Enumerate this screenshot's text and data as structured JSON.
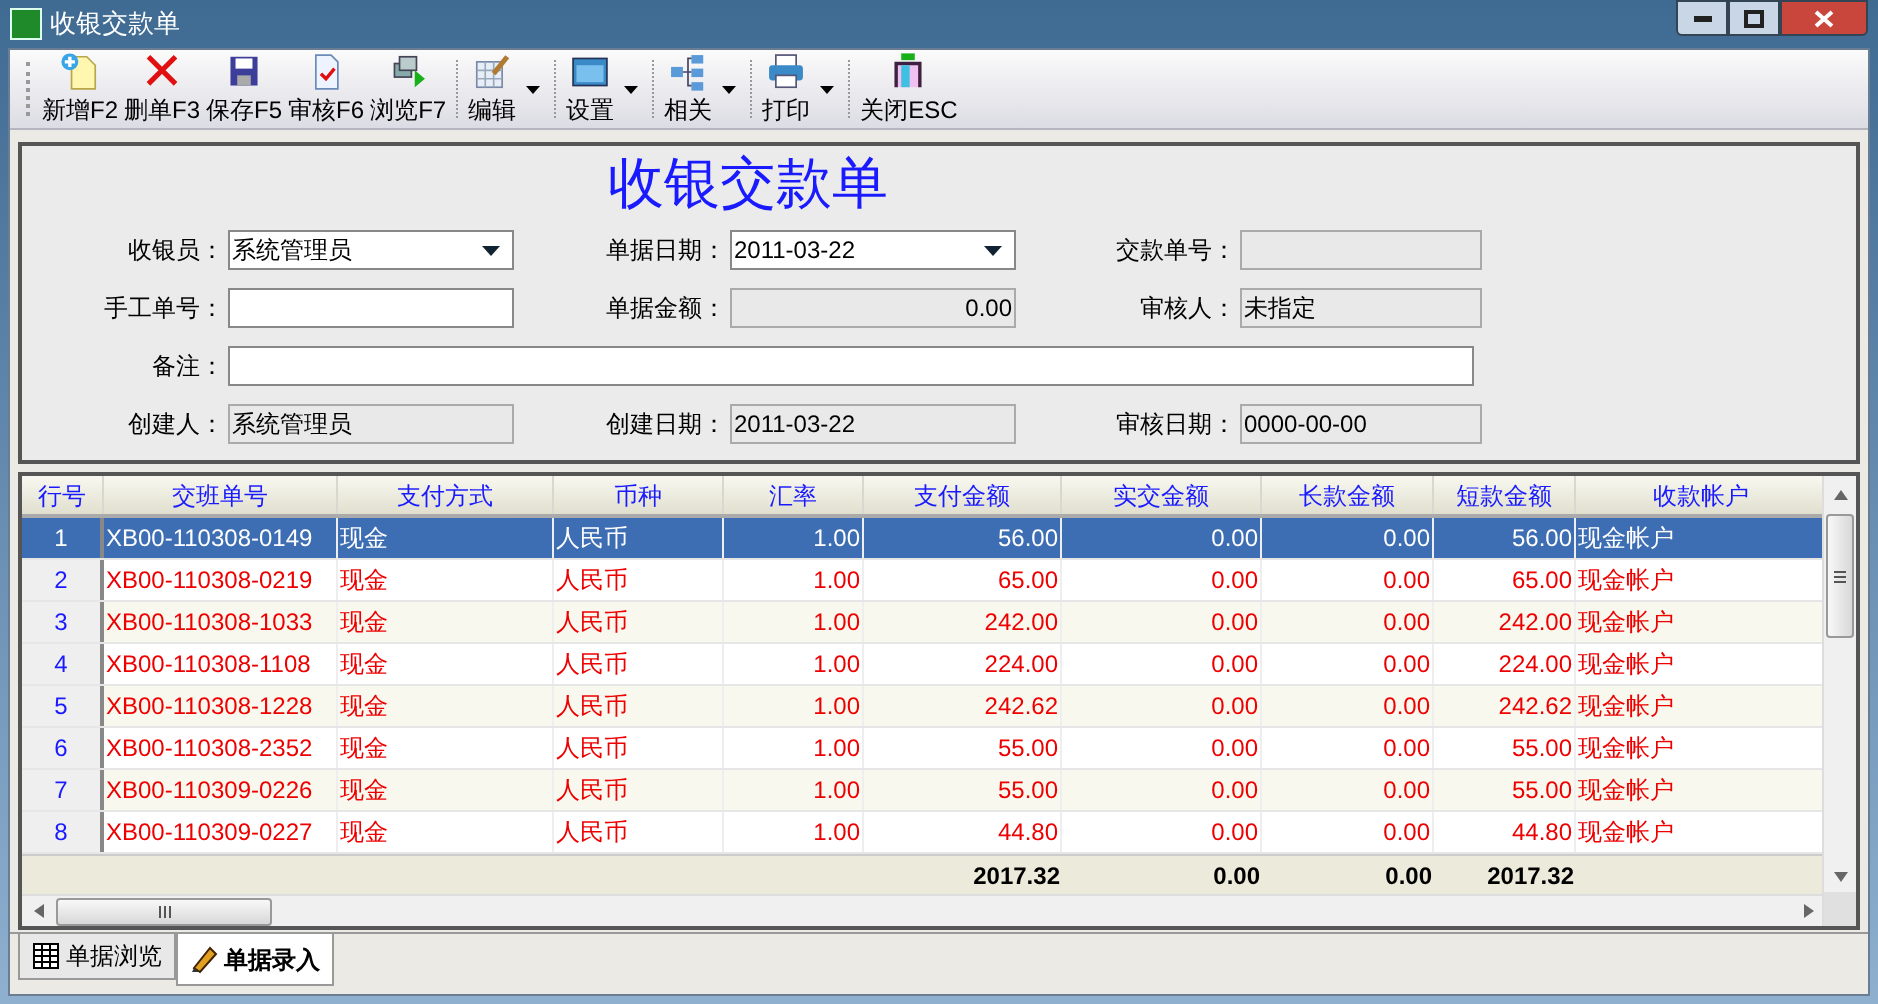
{
  "window": {
    "title": "收银交款单"
  },
  "toolbar": [
    {
      "kind": "new",
      "label": "新增F2",
      "dropdown": false
    },
    {
      "kind": "delete",
      "label": "删单F3",
      "dropdown": false
    },
    {
      "kind": "save",
      "label": "保存F5",
      "dropdown": false
    },
    {
      "kind": "audit",
      "label": "审核F6",
      "dropdown": false
    },
    {
      "kind": "browse",
      "label": "浏览F7",
      "dropdown": false
    },
    {
      "kind": "edit",
      "label": "编辑",
      "dropdown": true
    },
    {
      "kind": "settings",
      "label": "设置",
      "dropdown": true
    },
    {
      "kind": "related",
      "label": "相关",
      "dropdown": true
    },
    {
      "kind": "print",
      "label": "打印",
      "dropdown": true
    },
    {
      "kind": "close",
      "label": "关闭ESC",
      "dropdown": false
    }
  ],
  "form": {
    "title": "收银交款单",
    "rows": [
      [
        {
          "label": "收银员：",
          "kind": "combo",
          "value": "系统管理员"
        },
        {
          "label": "单据日期：",
          "kind": "combo",
          "value": "2011-03-22"
        },
        {
          "label": "交款单号：",
          "kind": "readonly"
        }
      ],
      [
        {
          "label": "手工单号：",
          "kind": "input"
        },
        {
          "label": "单据金额：",
          "kind": "readonly_number",
          "value": "0.00"
        },
        {
          "label": "审核人：",
          "kind": "readonly",
          "value": "未指定"
        }
      ],
      [
        {
          "label": "备注：",
          "kind": "wide_input"
        }
      ],
      [
        {
          "label": "创建人：",
          "kind": "readonly",
          "value": "系统管理员"
        },
        {
          "label": "创建日期：",
          "kind": "readonly",
          "value": "2011-03-22"
        },
        {
          "label": "审核日期：",
          "kind": "readonly",
          "value": "0000-00-00"
        }
      ]
    ]
  },
  "table": {
    "columns": [
      "行号",
      "交班单号",
      "支付方式",
      "币种",
      "汇率",
      "支付金额",
      "实交金额",
      "长款金额",
      "短款金额",
      "收款帐户"
    ],
    "rows": [
      {
        "selected": true,
        "cells": [
          "1",
          "XB00-110308-0149",
          "现金",
          "人民币",
          "1.00",
          "56.00",
          "0.00",
          "0.00",
          "56.00",
          "现金帐户"
        ]
      },
      {
        "selected": false,
        "cells": [
          "2",
          "XB00-110308-0219",
          "现金",
          "人民币",
          "1.00",
          "65.00",
          "0.00",
          "0.00",
          "65.00",
          "现金帐户"
        ]
      },
      {
        "selected": false,
        "cells": [
          "3",
          "XB00-110308-1033",
          "现金",
          "人民币",
          "1.00",
          "242.00",
          "0.00",
          "0.00",
          "242.00",
          "现金帐户"
        ]
      },
      {
        "selected": false,
        "cells": [
          "4",
          "XB00-110308-1108",
          "现金",
          "人民币",
          "1.00",
          "224.00",
          "0.00",
          "0.00",
          "224.00",
          "现金帐户"
        ]
      },
      {
        "selected": false,
        "cells": [
          "5",
          "XB00-110308-1228",
          "现金",
          "人民币",
          "1.00",
          "242.62",
          "0.00",
          "0.00",
          "242.62",
          "现金帐户"
        ]
      },
      {
        "selected": false,
        "cells": [
          "6",
          "XB00-110308-2352",
          "现金",
          "人民币",
          "1.00",
          "55.00",
          "0.00",
          "0.00",
          "55.00",
          "现金帐户"
        ]
      },
      {
        "selected": false,
        "cells": [
          "7",
          "XB00-110309-0226",
          "现金",
          "人民币",
          "1.00",
          "55.00",
          "0.00",
          "0.00",
          "55.00",
          "现金帐户"
        ]
      },
      {
        "selected": false,
        "cells": [
          "8",
          "XB00-110309-0227",
          "现金",
          "人民币",
          "1.00",
          "44.80",
          "0.00",
          "0.00",
          "44.80",
          "现金帐户"
        ]
      }
    ],
    "totals": {
      "支付金额": "2017.32",
      "实交金额": "0.00",
      "长款金额": "0.00",
      "短款金额": "2017.32"
    }
  },
  "tabs": [
    {
      "kind": "grid",
      "label": "单据浏览",
      "selected": false
    },
    {
      "kind": "pencil",
      "label": "单据录入",
      "selected": true
    }
  ]
}
